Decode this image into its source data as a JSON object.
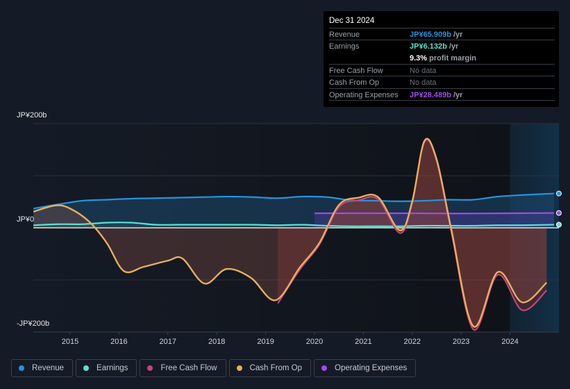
{
  "tooltip": {
    "date": "Dec 31 2024",
    "rows": [
      {
        "label": "Revenue",
        "value": "JP¥65.909b",
        "unit": " /yr",
        "color": "#2394df"
      },
      {
        "label": "Earnings",
        "value": "JP¥6.132b",
        "unit": " /yr",
        "color": "#5ee0d0"
      },
      {
        "label": "",
        "value": "9.3%",
        "unit": " profit margin",
        "color": "#ffffff"
      },
      {
        "label": "Free Cash Flow",
        "value": "No data",
        "unit": "",
        "color": "#6b7078"
      },
      {
        "label": "Cash From Op",
        "value": "No data",
        "unit": "",
        "color": "#6b7078"
      },
      {
        "label": "Operating Expenses",
        "value": "JP¥28.489b",
        "unit": " /yr",
        "color": "#a34ae8"
      }
    ]
  },
  "chart_data": {
    "type": "line",
    "ylim": [
      -200,
      200
    ],
    "y_ticks": [
      {
        "value": 200,
        "label": "JP¥200b"
      },
      {
        "value": 0,
        "label": "JP¥0"
      },
      {
        "value": -200,
        "label": "-JP¥200b"
      }
    ],
    "x_ticks": [
      "2015",
      "2016",
      "2017",
      "2018",
      "2019",
      "2020",
      "2021",
      "2022",
      "2023",
      "2024"
    ],
    "grid": true,
    "legend_position": "bottom",
    "highlight_from": 2024.0,
    "series": [
      {
        "name": "Revenue",
        "color": "#2394df",
        "x": [
          2014.25,
          2014.75,
          2015.25,
          2015.75,
          2016.25,
          2016.75,
          2017.25,
          2017.75,
          2018.25,
          2018.75,
          2019.25,
          2019.75,
          2020.25,
          2020.75,
          2021.25,
          2021.75,
          2022.25,
          2022.75,
          2023.25,
          2023.75,
          2024.25,
          2024.9
        ],
        "y": [
          37,
          45,
          52,
          54,
          56,
          57,
          58,
          59,
          60,
          59,
          57,
          60,
          59,
          53,
          52,
          51,
          52,
          54,
          54,
          60,
          63,
          65.9
        ]
      },
      {
        "name": "Earnings",
        "color": "#5ee0d0",
        "x": [
          2014.25,
          2014.75,
          2015.25,
          2015.75,
          2016.25,
          2016.75,
          2017.25,
          2017.75,
          2018.25,
          2018.75,
          2019.25,
          2019.75,
          2020.25,
          2020.75,
          2021.25,
          2021.75,
          2022.25,
          2022.75,
          2023.25,
          2023.75,
          2024.25,
          2024.9
        ],
        "y": [
          5,
          7,
          7,
          10,
          10,
          6,
          6,
          6,
          6,
          6,
          5,
          6,
          4,
          3,
          3,
          3,
          4,
          4,
          4,
          5,
          5,
          6.1
        ]
      },
      {
        "name": "Free Cash Flow",
        "color": "#c2457e",
        "x": [
          2019.25,
          2019.7,
          2020.1,
          2020.5,
          2020.9,
          2021.3,
          2021.75,
          2022.0,
          2022.25,
          2022.5,
          2022.8,
          2023.25,
          2023.75,
          2024.25,
          2024.75
        ],
        "y": [
          -145,
          -80,
          -32,
          40,
          53,
          55,
          -10,
          48,
          165,
          128,
          -8,
          -195,
          -90,
          -158,
          -120
        ]
      },
      {
        "name": "Cash From Op",
        "color": "#e8ae5a",
        "x": [
          2014.25,
          2014.7,
          2015.0,
          2015.4,
          2015.75,
          2016.1,
          2016.5,
          2017.0,
          2017.3,
          2017.75,
          2018.2,
          2018.7,
          2019.2,
          2019.7,
          2020.1,
          2020.5,
          2020.9,
          2021.3,
          2021.75,
          2022.0,
          2022.25,
          2022.5,
          2022.8,
          2023.25,
          2023.75,
          2024.25,
          2024.75
        ],
        "y": [
          31,
          43,
          37,
          11,
          -29,
          -83,
          -75,
          -63,
          -59,
          -107,
          -79,
          -96,
          -139,
          -76,
          -29,
          44,
          58,
          59,
          -5,
          51,
          167,
          131,
          -3,
          -189,
          -85,
          -143,
          -105
        ]
      },
      {
        "name": "Operating Expenses",
        "color": "#a34ae8",
        "x": [
          2020.0,
          2021.0,
          2022.0,
          2023.0,
          2024.0,
          2024.9
        ],
        "y": [
          28,
          28,
          28,
          27.5,
          28,
          28.5
        ]
      }
    ]
  },
  "legend": [
    {
      "label": "Revenue",
      "color": "#2394df"
    },
    {
      "label": "Earnings",
      "color": "#5ee0d0"
    },
    {
      "label": "Free Cash Flow",
      "color": "#c2457e"
    },
    {
      "label": "Cash From Op",
      "color": "#e8ae5a"
    },
    {
      "label": "Operating Expenses",
      "color": "#a34ae8"
    }
  ]
}
